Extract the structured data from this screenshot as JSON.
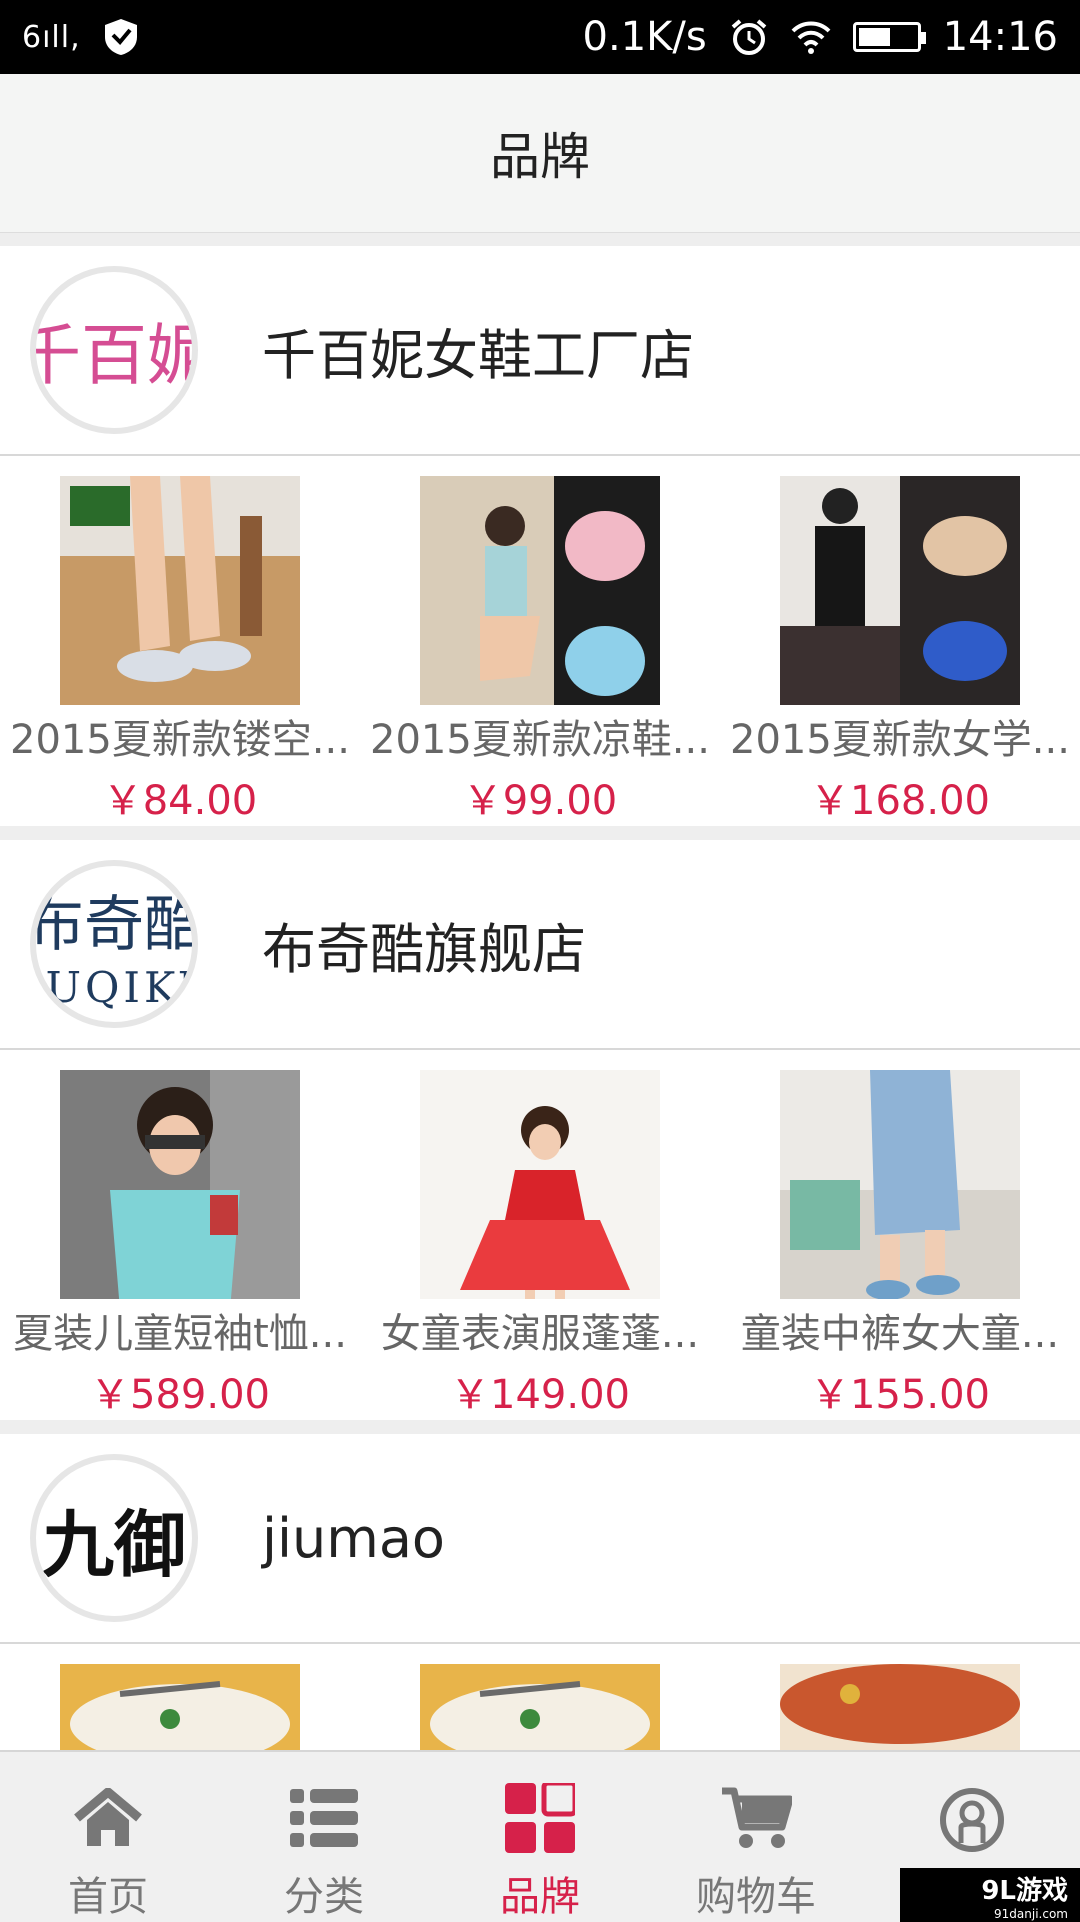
{
  "status_bar": {
    "signal": "6ıll,",
    "network_speed": "0.1K/s",
    "time": "14:16",
    "battery_level": 0.55
  },
  "header": {
    "title": "品牌"
  },
  "brands": [
    {
      "name": "千百妮女鞋工厂店",
      "logo_text": "千百妮",
      "logo_color": "#d54d93",
      "products": [
        {
          "name": "2015夏新款镂空...",
          "price": "￥84.00"
        },
        {
          "name": "2015夏新款凉鞋...",
          "price": "￥99.00"
        },
        {
          "name": "2015夏新款女学...",
          "price": "￥168.00"
        }
      ]
    },
    {
      "name": "布奇酷旗舰店",
      "logo_text": "布奇酷",
      "logo_subtext": "BUQIKU",
      "logo_color": "#1f3b5e",
      "products": [
        {
          "name": "夏装儿童短袖t恤...",
          "price": "￥589.00"
        },
        {
          "name": "女童表演服蓬蓬...",
          "price": "￥149.00"
        },
        {
          "name": "童装中裤女大童...",
          "price": "￥155.00"
        }
      ]
    },
    {
      "name": "jiumao",
      "logo_text": "九御",
      "logo_color": "#111111",
      "products": [
        {
          "name": "",
          "price": ""
        },
        {
          "name": "",
          "price": ""
        },
        {
          "name": "",
          "price": ""
        }
      ]
    }
  ],
  "bottom_nav": {
    "items": [
      {
        "label": "首页",
        "icon": "home-icon",
        "active": false
      },
      {
        "label": "分类",
        "icon": "list-icon",
        "active": false
      },
      {
        "label": "品牌",
        "icon": "brand-grid-icon",
        "active": true
      },
      {
        "label": "购物车",
        "icon": "cart-icon",
        "active": false
      },
      {
        "label": "",
        "icon": "user-icon",
        "active": false
      }
    ]
  },
  "watermark": {
    "brand": "9L游戏",
    "url": "91danji.com"
  },
  "colors": {
    "accent": "#d6214a",
    "header_bg": "#f4f5f4",
    "nav_bg": "#f0f0f0"
  }
}
